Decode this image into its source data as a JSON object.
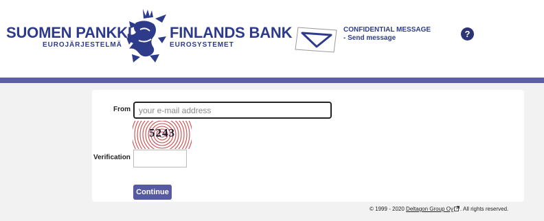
{
  "header": {
    "logo_fi": {
      "main": "SUOMEN PANKKI",
      "sub": "EUROJÄRJESTELMÄ"
    },
    "logo_sv": {
      "main": "FINLANDS BANK",
      "sub": "EUROSYSTEMET"
    },
    "conf_title": "CONFIDENTIAL MESSAGE",
    "conf_sub": "- Send message",
    "help_label": "?"
  },
  "form": {
    "from_label": "From",
    "from_placeholder": "your e-mail address",
    "from_value": "",
    "captcha_text": "5243",
    "verification_label": "Verification",
    "verification_value": "",
    "continue_label": "Continue"
  },
  "footer": {
    "prefix": "© 1999 - 2020 ",
    "company_link": "Deltagon Group Oy",
    "suffix": ". All rights reserved."
  },
  "colors": {
    "brand_blue": "#2e3b8a",
    "bar": "#5c5fa6",
    "button": "#565aa0",
    "captcha_rings": "#d04848"
  },
  "icons": [
    "lion-emblem-icon",
    "envelope-icon",
    "help-icon",
    "external-link-icon"
  ]
}
